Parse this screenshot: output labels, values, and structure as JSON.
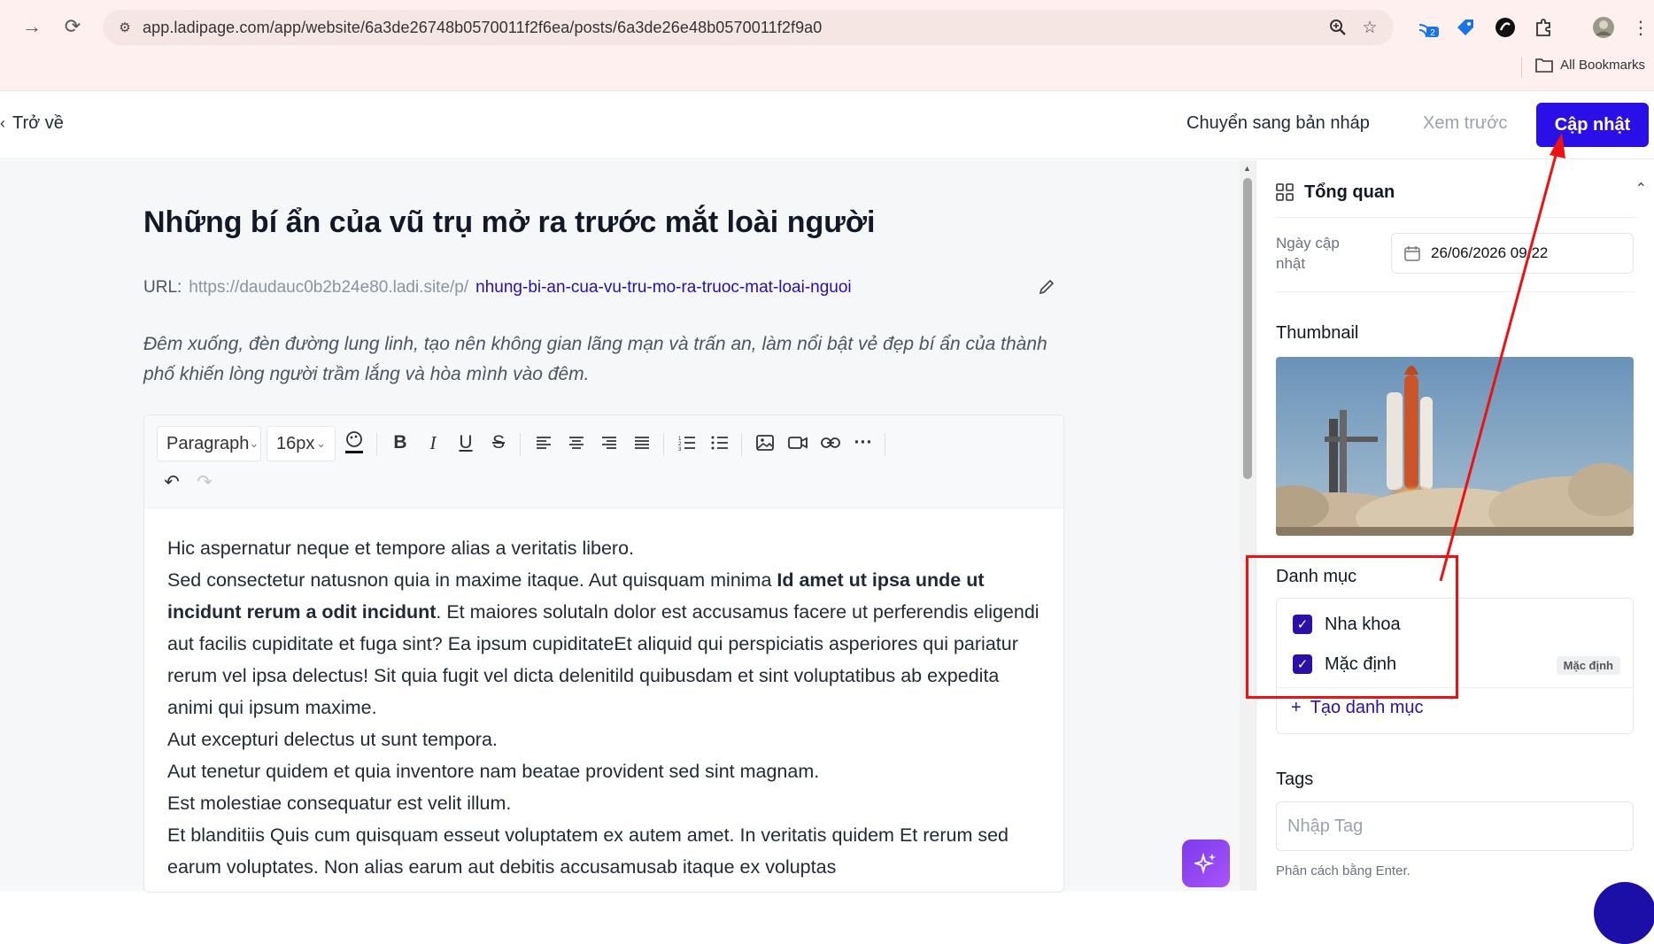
{
  "browser": {
    "url": "app.ladipage.com/app/website/6a3de26748b0570011f2f6ea/posts/6a3de26e48b0570011f2f9a0",
    "extension_badge": "2",
    "bookmarks_label": "All Bookmarks",
    "icons": [
      "forward-icon",
      "reload-icon",
      "site-info-icon",
      "zoom-icon",
      "star-icon",
      "extensions-icon",
      "profile-avatar"
    ]
  },
  "header": {
    "back_label": "Trở về",
    "draft_label": "Chuyển sang bản nháp",
    "preview_label": "Xem trước",
    "update_label": "Cập nhật"
  },
  "post": {
    "title": "Những bí ẩn của vũ trụ mở ra trước mắt loài người",
    "url_label": "URL:",
    "url_base": "https://daudauc0b2b24e80.ladi.site/p/",
    "url_slug": "nhung-bi-an-cua-vu-tru-mo-ra-truoc-mat-loai-nguoi",
    "description": "Đêm xuống, đèn đường lung linh, tạo nên không gian lãng mạn và trấn an, làm nổi bật vẻ đẹp bí ẩn của thành phố khiến lòng người trầm lắng và hòa mình vào đêm."
  },
  "toolbar": {
    "block_type": "Paragraph",
    "font_size": "16px"
  },
  "content": {
    "p1": "Hic aspernatur neque et tempore alias a veritatis libero.",
    "p2_before": "Sed consectetur natusnon quia in maxime itaque. Aut quisquam minima ",
    "p2_bold": "Id amet ut ipsa unde ut incidunt rerum a odit incidunt",
    "p2_after": ". Et maiores solutaln dolor est accusamus facere ut perferendis eligendi aut facilis cupiditate et fuga sint? Ea ipsum cupiditateEt aliquid qui perspiciatis asperiores qui pariatur rerum vel ipsa delectus! Sit quia fugit vel dicta delenitild quibusdam et sint voluptatibus ab expedita animi qui ipsum maxime.",
    "p3": "Aut excepturi delectus ut sunt tempora.",
    "p4": "Aut tenetur quidem et quia inventore nam beatae provident sed sint magnam.",
    "p5": "Est molestiae consequatur est velit illum.",
    "p6": "Et blanditiis Quis cum quisquam esseut voluptatem ex autem amet. In veritatis quidem Et rerum sed earum voluptates. Non alias earum aut debitis accusamusab itaque ex voluptas"
  },
  "sidebar": {
    "overview_title": "Tổng quan",
    "date_label": "Ngày cập nhật",
    "date_value": "26/06/2026 09:22",
    "thumbnail_label": "Thumbnail",
    "category_label": "Danh mục",
    "categories": [
      {
        "label": "Nha khoa",
        "checked": true
      },
      {
        "label": "Mặc định",
        "checked": true
      }
    ],
    "default_badge": "Mặc định",
    "create_category": "Tạo danh mục",
    "tags_label": "Tags",
    "tags_placeholder": "Nhập Tag",
    "tags_hint": "Phân cách bằng Enter."
  },
  "colors": {
    "accent": "#2a10e6",
    "annotation": "#ee1111"
  }
}
